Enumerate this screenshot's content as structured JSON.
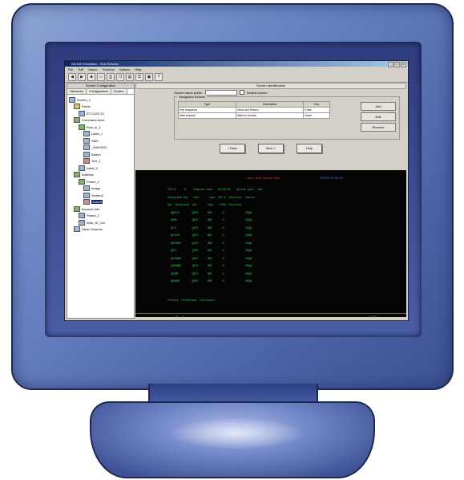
{
  "window": {
    "title": "AS/400 Emulation - Host Session",
    "controls": [
      "_",
      "□",
      "x"
    ]
  },
  "menu": [
    "File",
    "Edit",
    "Macro",
    "Terminal",
    "Options",
    "Help"
  ],
  "toolbar_icons": [
    "back-icon",
    "forward-icon",
    "stop-icon",
    "screen-icon",
    "print-icon",
    "copy-icon",
    "paste-icon",
    "key-icon",
    "macro-icon",
    "help-icon"
  ],
  "left_panel": {
    "title": "Screen Configuration",
    "tabs": [
      "Hierarchy",
      "Configuration",
      "Screen"
    ],
    "tree": [
      {
        "label": "Screen_1",
        "level": 0,
        "icon": "blue"
      },
      {
        "label": "Fields",
        "level": 1,
        "icon": "y"
      },
      {
        "label": "ET-CUST-ID",
        "level": 2,
        "icon": "blue"
      },
      {
        "label": "Command Area",
        "level": 1,
        "icon": "g"
      },
      {
        "label": "Row_ln_1",
        "level": 2,
        "icon": "g"
      },
      {
        "label": "Label_1",
        "level": 3,
        "icon": "blue"
      },
      {
        "label": "SMS",
        "level": 3,
        "icon": "blue"
      },
      {
        "label": "_IMAGE02",
        "level": 3,
        "icon": "blue"
      },
      {
        "label": "Button",
        "level": 3,
        "icon": "blue"
      },
      {
        "label": "Text_1",
        "level": 3,
        "icon": "r"
      },
      {
        "label": "Label_2",
        "level": 2,
        "icon": "blue"
      },
      {
        "label": "Address",
        "level": 1,
        "icon": "g"
      },
      {
        "label": "Frame_1",
        "level": 2,
        "icon": "g"
      },
      {
        "label": "Image",
        "level": 3,
        "icon": "blue"
      },
      {
        "label": "Screen2",
        "level": 3,
        "icon": "blue"
      },
      {
        "label": "Submit",
        "level": 3,
        "icon": "r",
        "selected": true
      },
      {
        "label": "Account Info",
        "level": 1,
        "icon": "g"
      },
      {
        "label": "Frame_2",
        "level": 2,
        "icon": "blue"
      },
      {
        "label": "Web_ID_Ctrl",
        "level": 2,
        "icon": "blue"
      },
      {
        "label": "Other Screens",
        "level": 1,
        "icon": "blue"
      }
    ]
  },
  "right_panel": {
    "section_title": "Screen Identification",
    "screen_name_label": "Screen name prefix:",
    "checkbox_label": "Default screen",
    "group_title": "Navigation Actions",
    "table": {
      "headers": [
        "Type",
        "Description",
        "Key"
      ],
      "rows": [
        [
          "Key sequence",
          "Send and Return",
          "Enter"
        ],
        [
          "Wait request",
          "Wait for Screen",
          "None"
        ]
      ]
    },
    "side_buttons": [
      "Add",
      "Edit",
      "Remove"
    ],
    "nav_buttons": [
      "< Back",
      "Next >",
      "Help"
    ]
  },
  "terminal": {
    "header_left": "Work with Active Jobs",
    "header_right": "SYSTEM 01/02/03",
    "lines": [
      "CPU %:    .0     Elapsed time:   00:00:00    Active jobs:  212",
      "Subsystem/Job    User      Type  CPU %  Function   Status",
      "Opt  Subsystem  Job       Type    CPU%  Function",
      "  QBATCH        QSYS      SBS      .0              DEQW",
      "  QCMN          QSYS      SBS      .0              DEQW",
      "  QCTL          QSYS      SBS      .0              DEQW",
      "  QINTER        QSYS      SBS      .0              DEQW",
      "  QSERVER       QSYS      SBS      .0              DEQW",
      "  QSPL          QSYS      SBS      .0              DEQW",
      "  QSYSWRK       QSYS      SBS      .0              DEQW",
      "  QUSRWRK       QSYS      SBS      .0              DEQW",
      "  QPGMR         QSYS      SBS      .0              DEQW",
      "  QSNADS        QSYS      SBS      .0              DEQW"
    ],
    "footer": "F3=Exit  F5=Refresh  F12=Cancel",
    "status_left": "MA  A",
    "status_right": "12/075"
  }
}
